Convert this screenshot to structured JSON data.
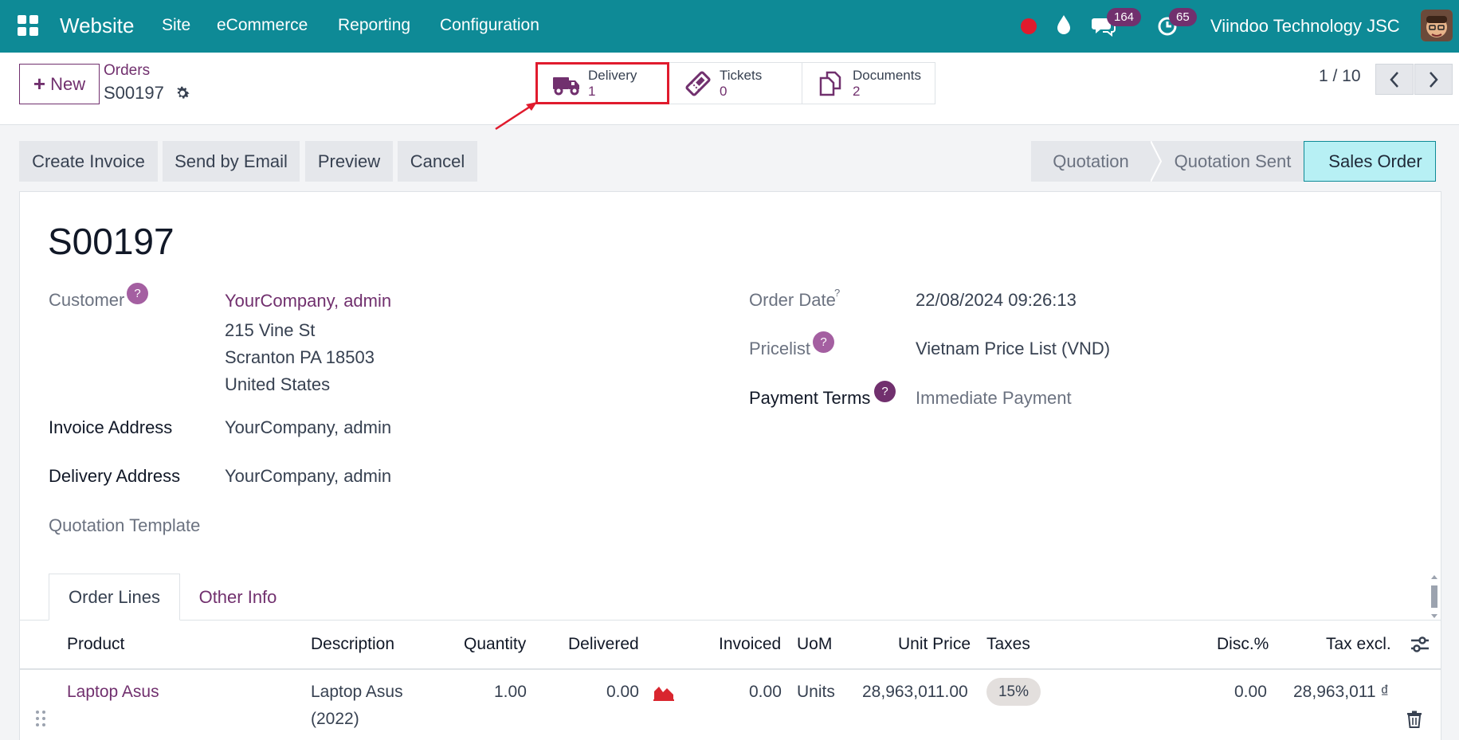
{
  "navbar": {
    "app_name": "Website",
    "menus": [
      "Site",
      "eCommerce",
      "Reporting",
      "Configuration"
    ],
    "chat_badge": "164",
    "activity_badge": "65",
    "company": "Viindoo Technology JSC",
    "accent": "#0e8a96"
  },
  "control_panel": {
    "new_label": "New",
    "breadcrumb_parent": "Orders",
    "breadcrumb_current": "S00197",
    "smart_buttons": [
      {
        "label": "Delivery",
        "value": "1",
        "icon": "truck-icon"
      },
      {
        "label": "Tickets",
        "value": "0",
        "icon": "ticket-icon"
      },
      {
        "label": "Documents",
        "value": "2",
        "icon": "documents-icon"
      }
    ],
    "pager": "1 / 10"
  },
  "actions": [
    "Create Invoice",
    "Send by Email",
    "Preview",
    "Cancel"
  ],
  "status_stages": [
    "Quotation",
    "Quotation Sent",
    "Sales Order"
  ],
  "active_stage": "Sales Order",
  "form": {
    "name": "S00197",
    "customer_label": "Customer",
    "customer_name": "YourCompany, admin",
    "customer_street": "215 Vine St",
    "customer_city": "Scranton PA 18503",
    "customer_country": "United States",
    "invoice_address_label": "Invoice Address",
    "invoice_address": "YourCompany, admin",
    "delivery_address_label": "Delivery Address",
    "delivery_address": "YourCompany, admin",
    "quotation_template_label": "Quotation Template",
    "order_date_label": "Order Date",
    "order_date": "22/08/2024 09:26:13",
    "pricelist_label": "Pricelist",
    "pricelist": "Vietnam Price List (VND)",
    "payment_terms_label": "Payment Terms",
    "payment_terms": "Immediate Payment",
    "help_mark": "?"
  },
  "tabs": [
    "Order Lines",
    "Other Info"
  ],
  "table": {
    "headers": [
      "Product",
      "Description",
      "Quantity",
      "Delivered",
      "Invoiced",
      "UoM",
      "Unit Price",
      "Taxes",
      "Disc.%",
      "Tax excl."
    ],
    "row": {
      "product": "Laptop Asus",
      "description_line1": "Laptop Asus",
      "description_line2": "(2022)",
      "quantity": "1.00",
      "delivered": "0.00",
      "invoiced": "0.00",
      "uom": "Units",
      "unit_price": "28,963,011.00",
      "tax": "15%",
      "discount": "0.00",
      "subtotal": "28,963,011 ₫"
    }
  }
}
